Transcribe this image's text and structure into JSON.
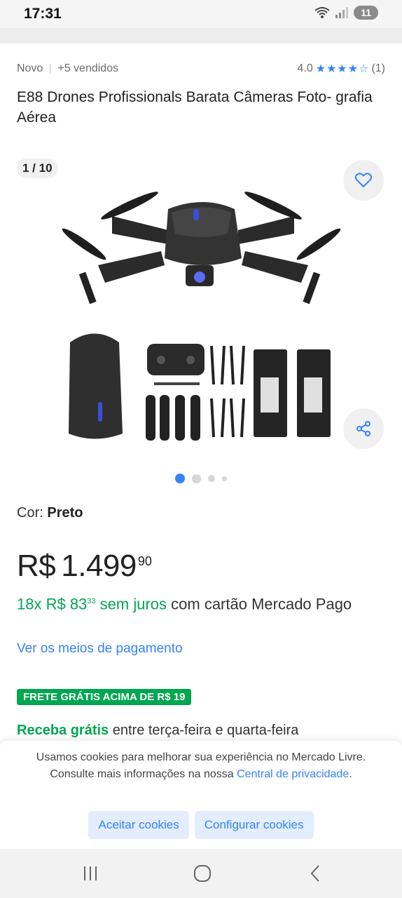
{
  "status": {
    "time": "17:31",
    "battery": "11"
  },
  "product": {
    "condition": "Novo",
    "sold": "+5 vendidos",
    "rating": "4.0",
    "reviews": "(1)",
    "title": "E88 Drones Profissionals Barata Câmeras Foto- grafia Aérea",
    "image_counter": "1 / 10",
    "color_label": "Cor:",
    "color_value": "Preto",
    "price_currency": "R$",
    "price_main": "1.499",
    "price_cents": "90",
    "installments_prefix": "18x R$ 83",
    "installments_cents": "33",
    "installments_suffix": " sem juros",
    "installments_rest": " com cartão Mercado Pago",
    "payment_link": "Ver os meios de pagamento",
    "shipping_badge": "FRETE GRÁTIS ACIMA DE R$ 19",
    "delivery_highlight": "Receba grátis",
    "delivery_rest": " entre terça-feira e quarta-feira"
  },
  "gallery": {
    "active_dot": 1,
    "dots": 4
  },
  "cookies": {
    "text_1": "Usamos cookies para melhorar sua experiência no Mercado Livre. Consulte mais informações na nossa ",
    "link": "Central de privacidade",
    "text_2": ".",
    "accept": "Aceitar cookies",
    "configure": "Configurar cookies"
  },
  "colors": {
    "accent": "#3483fa",
    "green": "#00a650"
  },
  "icons": [
    "wifi-icon",
    "signal-icon",
    "heart-icon",
    "share-icon",
    "star-icon",
    "recents-icon",
    "home-icon",
    "back-icon"
  ]
}
